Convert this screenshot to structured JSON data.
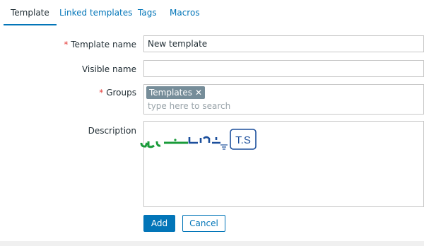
{
  "tabs": [
    {
      "label": "Template"
    },
    {
      "label": "Linked templates"
    },
    {
      "label": "Tags"
    },
    {
      "label": "Macros"
    }
  ],
  "form": {
    "required_marker": "*",
    "template_name": {
      "label": "Template name",
      "value": "New template"
    },
    "visible_name": {
      "label": "Visible name",
      "value": ""
    },
    "groups": {
      "label": "Groups",
      "selected": [
        "Templates"
      ],
      "remove_glyph": "✕",
      "placeholder": "type here to search"
    },
    "description": {
      "label": "Description",
      "logo": {
        "text_persian": "تهران سرور",
        "text_latin": "T.S",
        "colors": {
          "green": "#1a9b3a",
          "blue": "#1c4f9c"
        }
      }
    }
  },
  "buttons": {
    "add": "Add",
    "cancel": "Cancel"
  },
  "colors": {
    "accent": "#0275b8",
    "required": "#e33734",
    "tag_bg": "#768d99"
  }
}
